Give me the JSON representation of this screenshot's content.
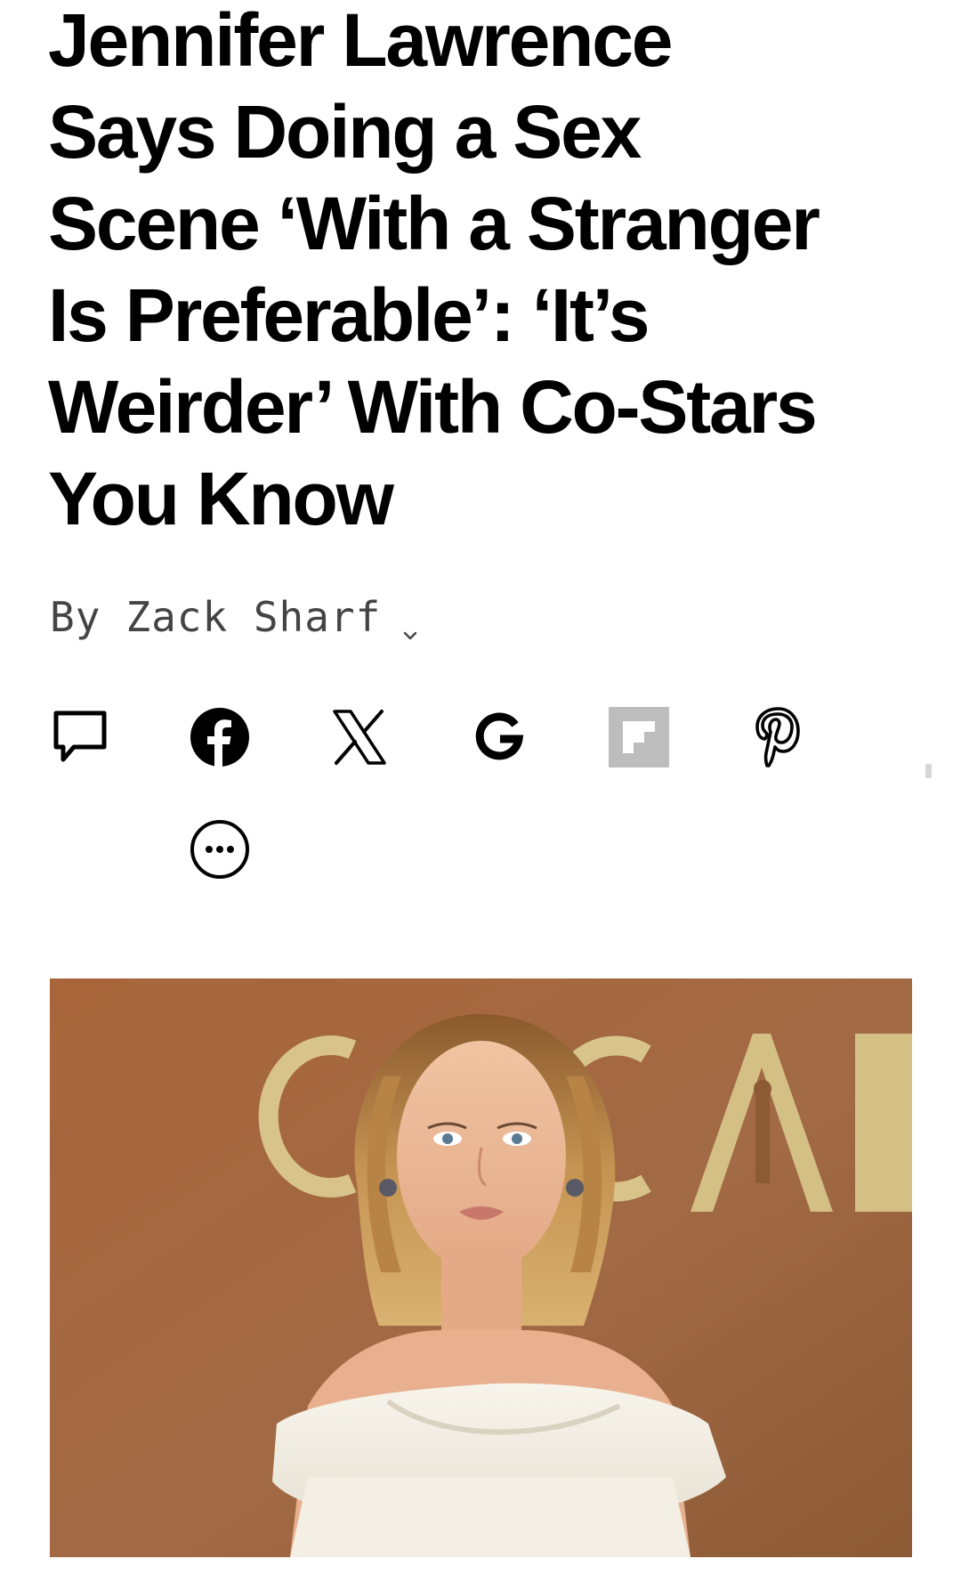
{
  "article": {
    "headline_lines": [
      "Jennifer Lawrence",
      "Says Doing a Sex",
      "Scene ‘With a Stranger",
      "Is Preferable’: ‘It’s",
      "Weirder’ With Co-Stars",
      "You Know"
    ],
    "byline": {
      "prefix": "By",
      "author": "Zack Sharf"
    }
  },
  "share": {
    "buttons": [
      {
        "icon": "comment-icon"
      },
      {
        "icon": "facebook-icon"
      },
      {
        "icon": "x-icon"
      },
      {
        "icon": "google-icon"
      },
      {
        "icon": "flipboard-icon"
      },
      {
        "icon": "pinterest-icon"
      },
      {
        "icon": "more-icon"
      }
    ]
  },
  "hero_image": {
    "backdrop_lettering": "OSCARS",
    "colors": {
      "backdrop": "#a66238",
      "lettering": "#d8c48a",
      "dress": "#f4f1e8"
    }
  }
}
